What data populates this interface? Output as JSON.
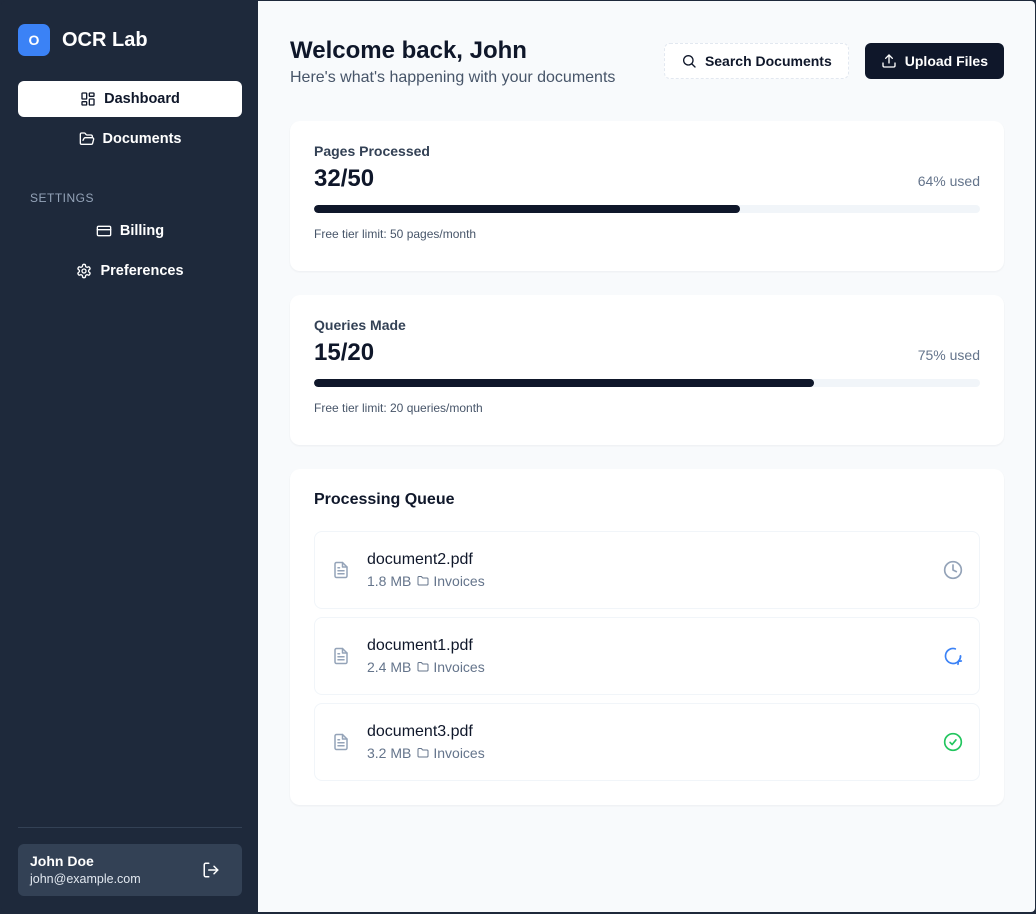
{
  "brand": {
    "logo_letter": "O",
    "name": "OCR Lab",
    "accent": "#3b82f6"
  },
  "sidebar": {
    "items": [
      {
        "label": "Dashboard",
        "icon": "dashboard-icon",
        "active": true
      },
      {
        "label": "Documents",
        "icon": "folder-open-icon",
        "active": false
      }
    ],
    "settings_heading": "SETTINGS",
    "settings_items": [
      {
        "label": "Billing",
        "icon": "credit-card-icon"
      },
      {
        "label": "Preferences",
        "icon": "gear-icon"
      }
    ],
    "user": {
      "name": "John Doe",
      "email": "john@example.com"
    }
  },
  "header": {
    "welcome": "Welcome back, John",
    "subtitle": "Here's what's happening with your documents",
    "search_label": "Search Documents",
    "upload_label": "Upload Files"
  },
  "stats": [
    {
      "label": "Pages Processed",
      "value": "32/50",
      "used": "64% used",
      "percent": 64,
      "note": "Free tier limit: 50 pages/month"
    },
    {
      "label": "Queries Made",
      "value": "15/20",
      "used": "75% used",
      "percent": 75,
      "note": "Free tier limit: 20 queries/month"
    }
  ],
  "queue": {
    "title": "Processing Queue",
    "items": [
      {
        "name": "document2.pdf",
        "size": "1.8 MB",
        "folder": "Invoices",
        "status": "pending",
        "status_icon": "clock-icon",
        "status_color": "#94a3b8"
      },
      {
        "name": "document1.pdf",
        "size": "2.4 MB",
        "folder": "Invoices",
        "status": "processing",
        "status_icon": "refresh-icon",
        "status_color": "#3b82f6"
      },
      {
        "name": "document3.pdf",
        "size": "3.2 MB",
        "folder": "Invoices",
        "status": "completed",
        "status_icon": "check-circle-icon",
        "status_color": "#22c55e"
      }
    ]
  }
}
